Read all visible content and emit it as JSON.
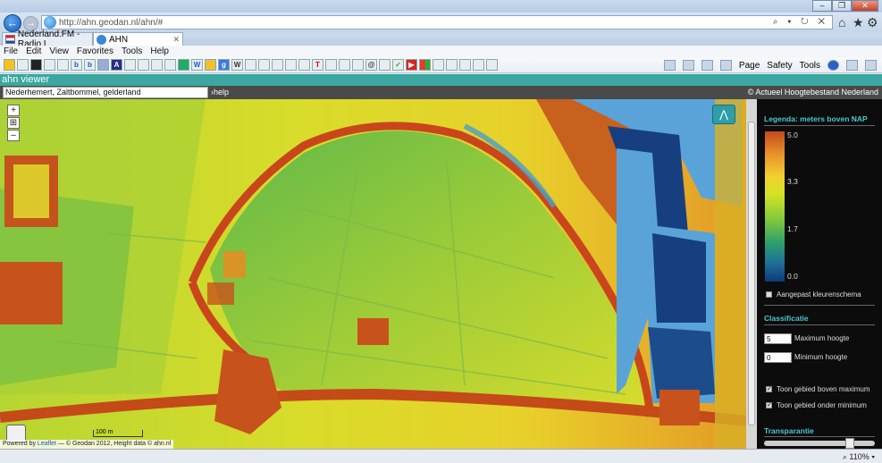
{
  "browser": {
    "url": "http://ahn.geodan.nl/ahn/#",
    "tabs": [
      {
        "label": "Nederland.FM - Radio I..."
      },
      {
        "label": "AHN"
      }
    ],
    "menu": [
      "File",
      "Edit",
      "View",
      "Favorites",
      "Tools",
      "Help"
    ],
    "command_bar": {
      "page": "Page",
      "safety": "Safety",
      "tools": "Tools"
    },
    "zoom_level": "110%"
  },
  "app": {
    "title": "ahn viewer",
    "search_value": "Nederhemert, Zaltbommel, gelderland",
    "help_link": "help",
    "copyright": "© Actueel Hoogtebestand Nederland"
  },
  "map": {
    "scale_label": "100 m",
    "attribution_prefix": "Powered by",
    "attribution_link": "Leaflet",
    "attribution_rest": " — © Geodan 2012, Height data © ahn.nl",
    "colors": {
      "low": "#0e3a7a",
      "water": "#5aa3d8",
      "mid": "#8ec23a",
      "high": "#c8501e"
    }
  },
  "panel": {
    "legend_title": "Legenda: meters boven NAP",
    "legend_ticks": [
      "5.0",
      "3.3",
      "1.7",
      "0.0"
    ],
    "custom_scheme_label": "Aangepast kleurenschema",
    "classification_title": "Classificatie",
    "max_height_label": "Maximum hoogte",
    "max_height_value": "5",
    "min_height_label": "Minimum hoogte",
    "min_height_value": "0",
    "show_above_label": "Toon gebied boven maximum",
    "show_below_label": "Toon gebied onder minimum",
    "transparency_title": "Transparantie",
    "transparency_value": 0.8,
    "custom_scheme_checked": false,
    "show_above_checked": true,
    "show_below_checked": true
  }
}
